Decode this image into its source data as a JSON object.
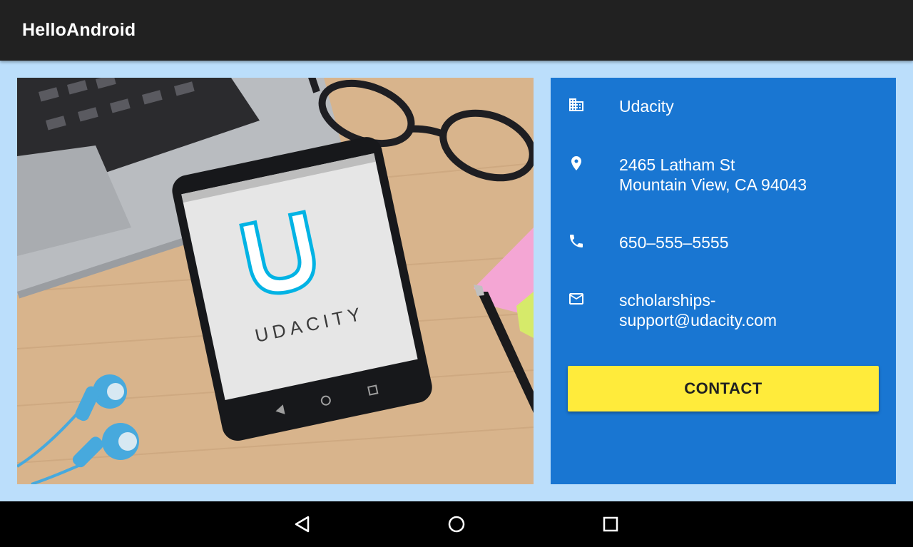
{
  "app_bar": {
    "title": "HelloAndroid"
  },
  "header_image": {
    "name": "desk-photo-with-phone",
    "phone_screen_text": "UDACITY"
  },
  "contact_card": {
    "items": [
      {
        "icon": "business-icon",
        "lines": [
          "Udacity"
        ]
      },
      {
        "icon": "location-pin-icon",
        "lines": [
          "2465 Latham St",
          "Mountain View, CA 94043"
        ]
      },
      {
        "icon": "phone-icon",
        "lines": [
          "650–555–5555"
        ]
      },
      {
        "icon": "email-icon",
        "lines": [
          "scholarships-",
          "support@udacity.com"
        ]
      }
    ],
    "button_label": "CONTACT"
  },
  "nav_bar": {
    "buttons": [
      "back-icon",
      "home-icon",
      "recents-icon"
    ]
  },
  "colors": {
    "app_bar": "#212121",
    "background": "#bbdefb",
    "card": "#1976d2",
    "button": "#ffeb3b",
    "text_on_card": "#ffffff"
  }
}
